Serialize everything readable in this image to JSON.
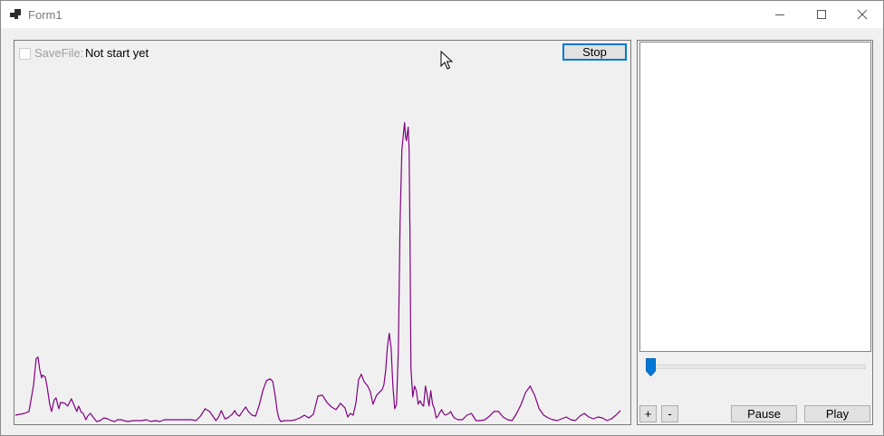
{
  "window": {
    "title": "Form1",
    "icon": "app-icon"
  },
  "controls": {
    "minimize_icon": "minimize-icon",
    "maximize_icon": "maximize-icon",
    "close_icon": "close-icon"
  },
  "toolbar": {
    "savefile_label": "SaveFile:",
    "savefile_checked": false,
    "status_text": "Not start yet",
    "stop_label": "Stop"
  },
  "side": {
    "list_items": [],
    "slider_value": 0,
    "plus_label": "+",
    "minus_label": "-",
    "pause_label": "Pause",
    "play_label": "Play"
  },
  "chart_data": {
    "type": "line",
    "line_color": "#800080",
    "background": "#f0f0f0",
    "grid": false,
    "x": [
      0,
      5,
      10,
      15,
      20,
      23,
      25,
      27,
      29,
      30,
      33,
      35,
      38,
      40,
      43,
      45,
      48,
      50,
      55,
      58,
      62,
      65,
      68,
      70,
      73,
      75,
      78,
      80,
      83,
      86,
      90,
      94,
      98,
      102,
      106,
      110,
      113,
      117,
      120,
      125,
      130,
      135,
      140,
      145,
      150,
      155,
      160,
      165,
      170,
      175,
      180,
      185,
      190,
      195,
      200,
      205,
      210,
      215,
      220,
      222,
      225,
      228,
      232,
      235,
      240,
      243,
      245,
      248,
      252,
      255,
      258,
      262,
      266,
      270,
      274,
      278,
      282,
      285,
      288,
      290,
      292,
      294,
      298,
      302,
      306,
      310,
      315,
      320,
      325,
      330,
      335,
      340,
      345,
      350,
      355,
      360,
      365,
      368,
      371,
      374,
      377,
      380,
      383,
      386,
      390,
      393,
      396,
      400,
      403,
      406,
      408,
      410,
      412,
      414,
      416,
      418,
      420,
      422,
      424,
      426,
      428,
      430,
      431,
      432,
      433,
      434,
      435,
      436,
      437,
      438,
      440,
      442,
      444,
      446,
      448,
      450,
      452,
      454,
      456,
      458,
      460,
      462,
      464,
      466,
      468,
      470,
      472,
      474,
      476,
      478,
      480,
      482,
      484,
      486,
      490,
      495,
      500,
      505,
      510,
      515,
      520,
      525,
      530,
      535,
      540,
      545,
      550,
      555,
      560,
      565,
      570,
      575,
      580,
      585,
      590,
      595,
      600,
      605,
      610,
      615,
      620,
      625,
      630,
      635,
      640,
      645,
      650,
      655,
      660,
      665,
      670,
      675,
      679
    ],
    "y": [
      8,
      9,
      10,
      12,
      40,
      70,
      72,
      58,
      49,
      52,
      50,
      40,
      20,
      12,
      25,
      27,
      15,
      22,
      21,
      18,
      26,
      19,
      12,
      18,
      11,
      10,
      3,
      7,
      10,
      6,
      1,
      2,
      5,
      4,
      2,
      1,
      3,
      3,
      2,
      1,
      2,
      2,
      2,
      3,
      1,
      2,
      1,
      3,
      3,
      3,
      3,
      3,
      3,
      3,
      2,
      7,
      15,
      12,
      5,
      2,
      6,
      13,
      4,
      5,
      9,
      13,
      9,
      7,
      13,
      17,
      12,
      8,
      7,
      19,
      35,
      46,
      48,
      45,
      27,
      12,
      4,
      1,
      2,
      2,
      2,
      3,
      5,
      8,
      5,
      9,
      29,
      30,
      22,
      17,
      14,
      21,
      16,
      6,
      10,
      8,
      21,
      47,
      53,
      45,
      40,
      34,
      20,
      30,
      33,
      36,
      41,
      57,
      84,
      98,
      82,
      40,
      15,
      20,
      80,
      220,
      300,
      320,
      330,
      315,
      310,
      318,
      325,
      300,
      200,
      60,
      28,
      40,
      35,
      20,
      24,
      20,
      18,
      40,
      30,
      18,
      35,
      20,
      15,
      5,
      7,
      11,
      14,
      10,
      8,
      9,
      10,
      12,
      8,
      5,
      3,
      3,
      8,
      10,
      2,
      2,
      3,
      7,
      12,
      12,
      6,
      3,
      2,
      10,
      20,
      33,
      40,
      30,
      15,
      8,
      5,
      3,
      2,
      4,
      6,
      3,
      2,
      7,
      10,
      6,
      4,
      6,
      5,
      2,
      4,
      8,
      13
    ],
    "xlim": [
      0,
      680
    ],
    "ylim": [
      0,
      420
    ]
  }
}
